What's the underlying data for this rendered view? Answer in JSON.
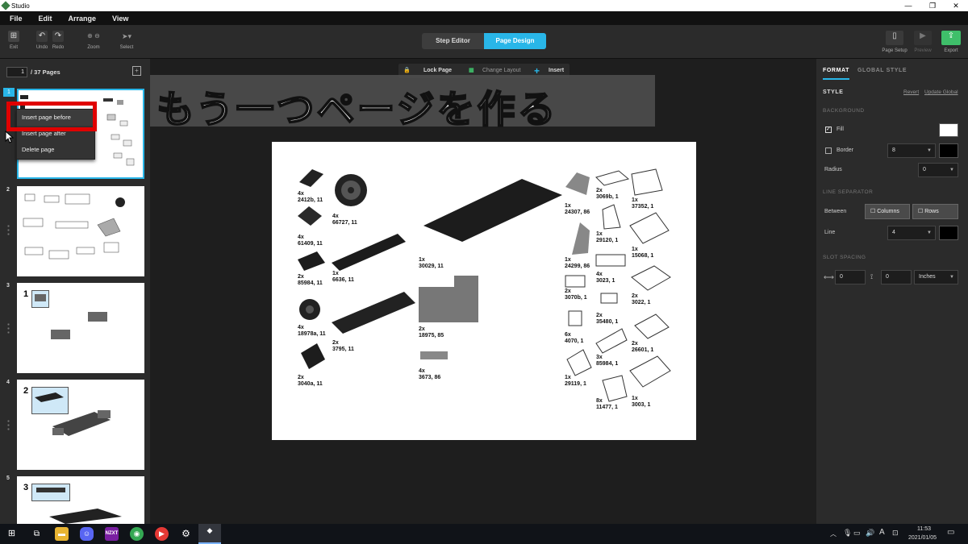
{
  "window": {
    "title": "Studio",
    "minimize": "—",
    "maximize": "❐",
    "close": "✕"
  },
  "menu": [
    "File",
    "Edit",
    "Arrange",
    "View"
  ],
  "toolbar": {
    "exit": "Exit",
    "undo": "Undo",
    "redo": "Redo",
    "zoom": "Zoom",
    "select": "Select",
    "tabs": {
      "step_editor": "Step Editor",
      "page_design": "Page Design"
    },
    "page_setup": "Page Setup",
    "preview": "Preview",
    "export": "Export"
  },
  "pages": {
    "current": "1",
    "total_label": "/ 37 Pages",
    "numbers": [
      "1",
      "2",
      "3",
      "4",
      "5"
    ],
    "callout_numbers": [
      "1",
      "2",
      "3"
    ]
  },
  "context_menu": [
    "Insert page before",
    "Insert page after",
    "Delete page"
  ],
  "canvas_tools": {
    "lock": "Lock Page",
    "layout": "Change Layout",
    "insert": "Insert"
  },
  "banner": "もう一つページを作る",
  "parts": [
    {
      "qty": "4x",
      "id": "2412b, 11"
    },
    {
      "qty": "4x",
      "id": "66727, 11"
    },
    {
      "qty": "4x",
      "id": "61409, 11"
    },
    {
      "qty": "2x",
      "id": "85984, 11"
    },
    {
      "qty": "1x",
      "id": "6636, 11"
    },
    {
      "qty": "1x",
      "id": "30029, 11"
    },
    {
      "qty": "4x",
      "id": "18978a, 11"
    },
    {
      "qty": "2x",
      "id": "3795, 11"
    },
    {
      "qty": "2x",
      "id": "18975, 85"
    },
    {
      "qty": "2x",
      "id": "3040a, 11"
    },
    {
      "qty": "4x",
      "id": "3673, 86"
    },
    {
      "qty": "1x",
      "id": "24307, 86"
    },
    {
      "qty": "2x",
      "id": "3069b, 1"
    },
    {
      "qty": "1x",
      "id": "37352, 1"
    },
    {
      "qty": "1x",
      "id": "29120, 1"
    },
    {
      "qty": "1x",
      "id": "24299, 86"
    },
    {
      "qty": "1x",
      "id": "15068, 1"
    },
    {
      "qty": "4x",
      "id": "3023, 1"
    },
    {
      "qty": "2x",
      "id": "3070b, 1"
    },
    {
      "qty": "2x",
      "id": "3022, 1"
    },
    {
      "qty": "2x",
      "id": "35480, 1"
    },
    {
      "qty": "6x",
      "id": "4070, 1"
    },
    {
      "qty": "2x",
      "id": "26601, 1"
    },
    {
      "qty": "3x",
      "id": "85984, 1"
    },
    {
      "qty": "1x",
      "id": "29119, 1"
    },
    {
      "qty": "8x",
      "id": "11477, 1"
    },
    {
      "qty": "1x",
      "id": "3003, 1"
    }
  ],
  "format": {
    "tabs": [
      "FORMAT",
      "GLOBAL STYLE"
    ],
    "style": "STYLE",
    "revert": "Revert",
    "update_global": "Update Global",
    "background": "BACKGROUND",
    "fill": "Fill",
    "border": "Border",
    "border_value": "8",
    "radius": "Radius",
    "radius_value": "0",
    "line_separator": "LINE SEPARATOR",
    "between": "Between",
    "columns": "Columns",
    "rows": "Rows",
    "line": "Line",
    "line_value": "4",
    "slot_spacing": "SLOT SPACING",
    "spacing_x": "0",
    "spacing_y": "0",
    "units": "Inches",
    "fill_color": "#ffffff",
    "border_color": "#000000"
  },
  "taskbar": {
    "apps": [
      "NZXT"
    ],
    "time": "11:53",
    "date": "2021/01/05",
    "ime": "A"
  },
  "colors": {
    "accent": "#29b6e8",
    "highlight": "#e00000",
    "export": "#3fbf6a"
  }
}
